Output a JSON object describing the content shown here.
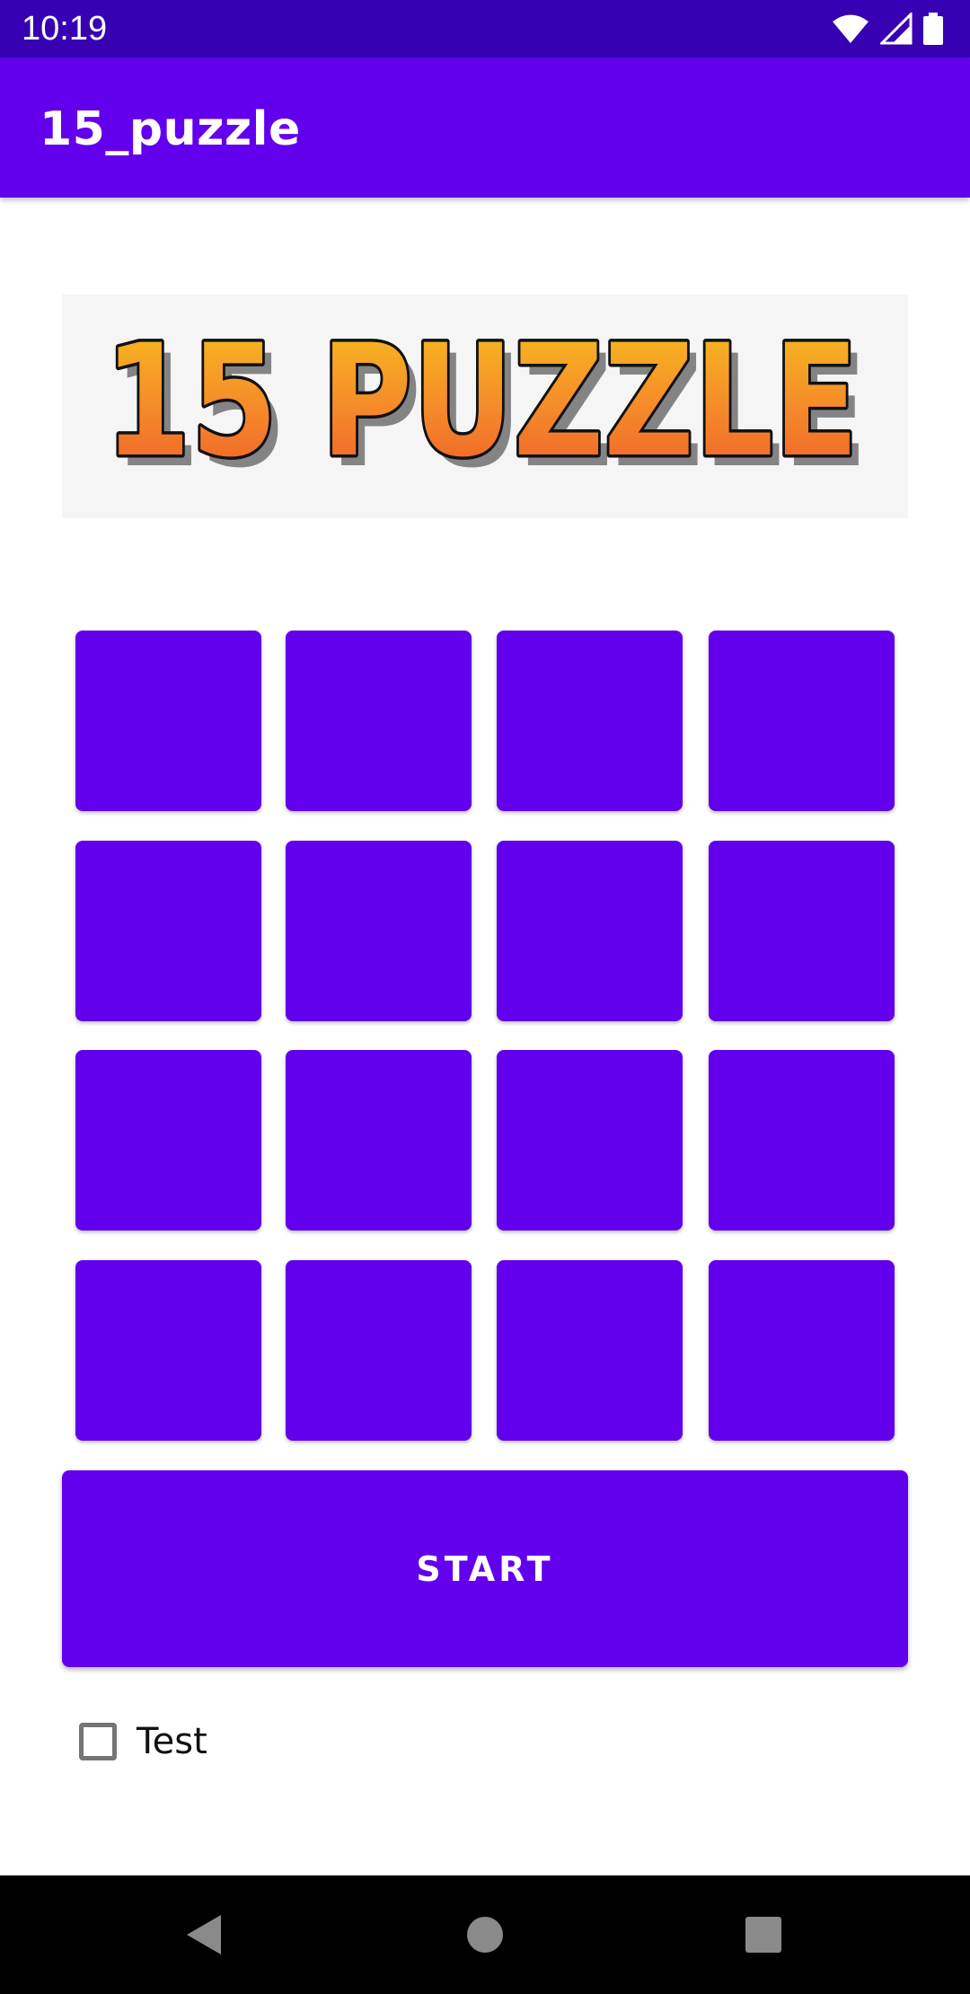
{
  "status_bar": {
    "time": "10:19",
    "icons": [
      "wifi-icon",
      "cell-signal-icon",
      "battery-icon"
    ]
  },
  "app_bar": {
    "title": "15_puzzle"
  },
  "logo": {
    "text": "15 PUZZLE"
  },
  "grid": {
    "tiles": [
      "",
      "",
      "",
      "",
      "",
      "",
      "",
      "",
      "",
      "",
      "",
      "",
      "",
      "",
      "",
      ""
    ]
  },
  "start_button": {
    "label": "START"
  },
  "test_checkbox": {
    "label": "Test",
    "checked": false
  },
  "nav_bar": {
    "icons": [
      "back-icon",
      "home-icon",
      "recents-icon"
    ]
  },
  "colors": {
    "status_bar": "#3700b3",
    "primary": "#6200ee",
    "background": "#ffffff",
    "nav_bar": "#000000"
  }
}
